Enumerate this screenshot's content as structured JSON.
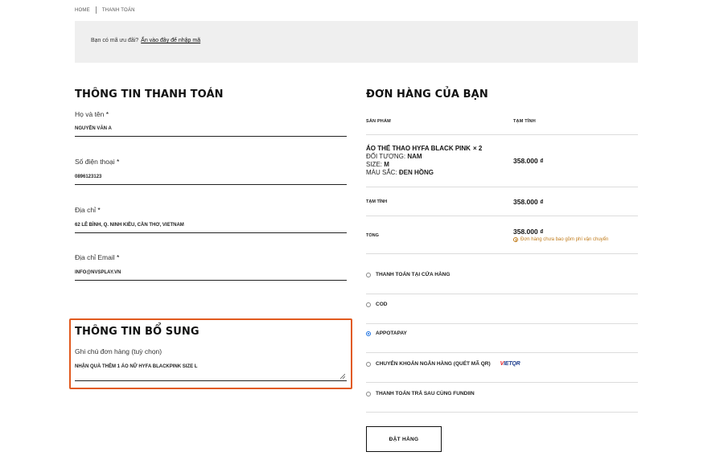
{
  "breadcrumb": {
    "home": "HOME",
    "current": "THANH TOÁN"
  },
  "coupon": {
    "text": "Bạn có mã ưu đãi?",
    "link": "Ấn vào đây để nhập mã"
  },
  "billing": {
    "title": "THÔNG TIN THANH TOÁN",
    "fields": [
      {
        "label": "Họ và tên",
        "value": "NGUYỄN VĂN A"
      },
      {
        "label": "Số điện thoại",
        "value": "0896123123"
      },
      {
        "label": "Địa chỉ",
        "value": "62 LÊ BÌNH, Q. NINH KIỀU, CẦN THƠ, VIETNAM"
      },
      {
        "label": "Địa chỉ Email",
        "value": "INFO@NVSPLAY.VN"
      }
    ],
    "required_mark": "*"
  },
  "extra": {
    "title": "THÔNG TIN BỔ SUNG",
    "note_label": "Ghi chú đơn hàng (tuỳ chọn)",
    "note_value": "NHẬN QUÀ THÊM 1 ÁO NỮ HYFA BLACKPINK SIZE L"
  },
  "order": {
    "title": "ĐƠN HÀNG CỦA BẠN",
    "col_product": "SẢN PHẨM",
    "col_subtotal": "TẠM TÍNH",
    "product": {
      "name": "ÁO THỂ THAO HYFA BLACK PINK",
      "qty": "× 2",
      "attrs": [
        {
          "key": "ĐỐI TƯỢNG:",
          "value": "NAM"
        },
        {
          "key": "SIZE:",
          "value": "M"
        },
        {
          "key": "MÀU SẮC:",
          "value": "ĐEN HỒNG"
        }
      ],
      "price": "358.000 ₫"
    },
    "subtotal_label": "TẠM TÍNH",
    "subtotal": "358.000 ₫",
    "total_label": "TỔNG",
    "total": "358.000 ₫",
    "shipping_note": "Đơn hàng chưa bao gồm phí vận chuyển"
  },
  "payment": {
    "methods": [
      {
        "label": "THANH TOÁN TẠI CỬA HÀNG",
        "selected": false
      },
      {
        "label": "COD",
        "selected": false
      },
      {
        "label": "APPOTAPAY",
        "selected": true
      },
      {
        "label": "CHUYỂN KHOẢN NGÂN HÀNG (QUÉT MÃ QR)",
        "selected": false,
        "logo_v": "V",
        "logo_rest": "IETQR"
      },
      {
        "label": "THANH TOÁN TRẢ SAU CÙNG FUNDIIN",
        "selected": false
      }
    ],
    "selected_color": "#1a6fe0"
  },
  "place_order": "ĐẶT HÀNG",
  "colors": {
    "highlight": "#e15a1f",
    "warning": "#c07a18",
    "panel": "#efefef"
  }
}
